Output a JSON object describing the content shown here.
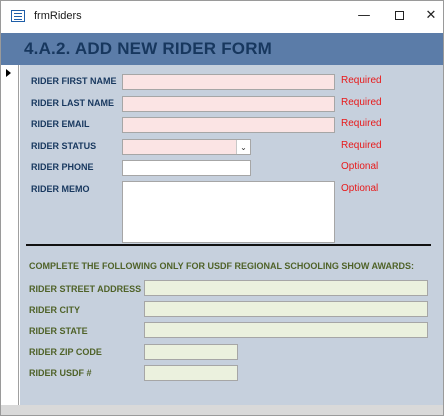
{
  "window": {
    "title": "frmRiders",
    "icon": "form-icon",
    "controls": {
      "minimize": "—",
      "maximize": "maximize-icon",
      "close": "✕"
    }
  },
  "header": {
    "title": "4.A.2. ADD NEW RIDER FORM"
  },
  "colors": {
    "header_bg": "#5b7ca8",
    "header_text": "#17375e",
    "body_bg": "#c6d0dd",
    "label_blue": "#17375e",
    "label_green": "#4f6228",
    "status_red": "#e8191a",
    "required_field": "#fbe4e4",
    "optional_green_field": "#ebf1de"
  },
  "rider": {
    "first_name": {
      "label": "RIDER FIRST NAME",
      "value": "",
      "status": "Required"
    },
    "last_name": {
      "label": "RIDER LAST NAME",
      "value": "",
      "status": "Required"
    },
    "email": {
      "label": "RIDER EMAIL",
      "value": "",
      "status": "Required"
    },
    "status": {
      "label": "RIDER STATUS",
      "value": "",
      "status": "Required"
    },
    "phone": {
      "label": "RIDER PHONE",
      "value": "",
      "status": "Optional"
    },
    "memo": {
      "label": "RIDER MEMO",
      "value": "",
      "status": "Optional"
    }
  },
  "usdf": {
    "instruction": "COMPLETE THE FOLLOWING ONLY FOR USDF REGIONAL SCHOOLING SHOW AWARDS:",
    "street": {
      "label": "RIDER STREET ADDRESS",
      "value": ""
    },
    "city": {
      "label": "RIDER CITY",
      "value": ""
    },
    "state": {
      "label": "RIDER STATE",
      "value": ""
    },
    "zip": {
      "label": "RIDER ZIP CODE",
      "value": ""
    },
    "usdf_number": {
      "label": "RIDER USDF #",
      "value": ""
    }
  }
}
